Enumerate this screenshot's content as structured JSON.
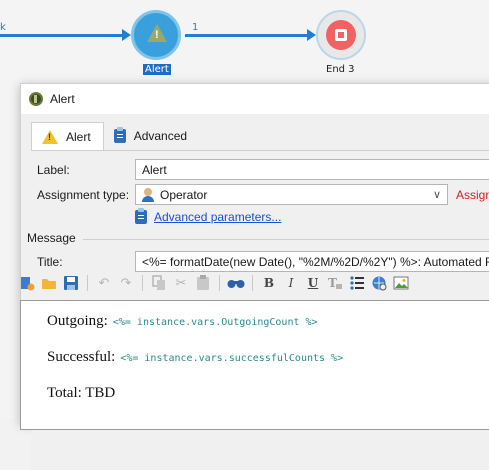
{
  "workflow": {
    "incoming_label": "k",
    "transition_label": "1",
    "alert_node_caption": "Alert",
    "end_node_caption": "End 3",
    "accent_color": "#1f7fd1"
  },
  "dialog": {
    "title": "Alert",
    "app_icon": "activity-icon",
    "tabs": [
      {
        "label": "Alert",
        "icon": "warning-icon",
        "active": true
      },
      {
        "label": "Advanced",
        "icon": "clipboard-icon",
        "active": false
      }
    ],
    "form": {
      "label_caption": "Label:",
      "label_value": "Alert",
      "assignment_caption": "Assignment type:",
      "assignment_value": "Operator",
      "assignment_truncated_red": "Assign",
      "advanced_params_link": "Advanced parameters..."
    },
    "message": {
      "group_title": "Message",
      "title_caption": "Title:",
      "title_value": "<%= formatDate(new Date(), \"%2M/%2D/%2Y\") %>: Automated R"
    },
    "toolbar": {
      "items": [
        "insert-icon",
        "open-folder-icon",
        "save-icon",
        "undo-icon",
        "redo-icon",
        "copy-icon",
        "cut-icon",
        "paste-icon",
        "find-icon",
        "bold-icon",
        "italic-icon",
        "underline-icon",
        "clear-format-icon",
        "list-icon",
        "link-icon",
        "image-icon"
      ],
      "bold": "B",
      "italic": "I",
      "underline": "U"
    },
    "editor": {
      "lines": [
        {
          "text": "Outgoing:",
          "code": "<%= instance.vars.OutgoingCount %>"
        },
        {
          "text": "Successful:",
          "code": "<%= instance.vars.successfulCounts %>"
        },
        {
          "text": "Total: TBD",
          "code": ""
        }
      ]
    }
  }
}
